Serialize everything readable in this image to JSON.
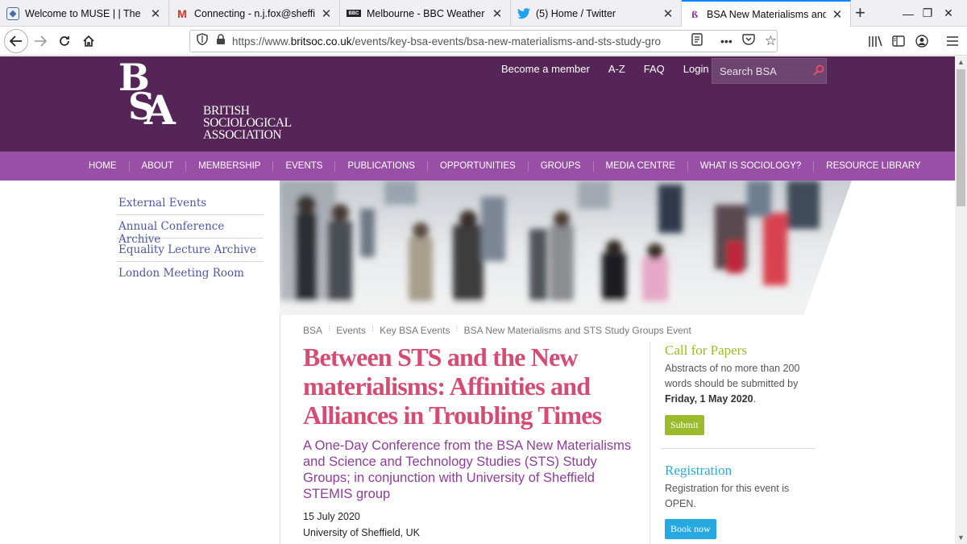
{
  "browser": {
    "tabs": [
      {
        "title": "Welcome to MUSE | | The Univ",
        "favicon": "shield-icon",
        "active": false
      },
      {
        "title": "Connecting - n.j.fox@sheffield.",
        "favicon": "gmail-icon",
        "active": false
      },
      {
        "title": "Melbourne - BBC Weather",
        "favicon": "bbc-icon",
        "active": false
      },
      {
        "title": "(5) Home / Twitter",
        "favicon": "twitter-icon",
        "active": false
      },
      {
        "title": "BSA New Materialisms and STS",
        "favicon": "bsa-icon",
        "active": true
      }
    ],
    "url_prefix": "https://www.",
    "url_domain": "britsoc.co.uk",
    "url_path": "/events/key-bsa-events/bsa-new-materialisms-and-sts-study-grou",
    "dots": "•••"
  },
  "site": {
    "logo_letters": "BSA",
    "logo_text_1": "BRITISH",
    "logo_text_2": "SOCIOLOGICAL",
    "logo_text_3": "ASSOCIATION",
    "top_links": [
      "Become a member",
      "A-Z",
      "FAQ",
      "Login"
    ],
    "search_placeholder": "Search BSA",
    "nav": [
      "Home",
      "About",
      "Membership",
      "Events",
      "Publications",
      "Opportunities",
      "Groups",
      "Media Centre",
      "What is Sociology?",
      "Resource Library"
    ],
    "sidebar": [
      "External Events",
      "Annual Conference Archive",
      "Equality Lecture Archive",
      "London Meeting Room"
    ],
    "breadcrumb": [
      "BSA",
      "Events",
      "Key BSA Events",
      "BSA New Materialisms and STS Study Groups Event"
    ],
    "title": "Between STS and the New materialisms: Affinities and Alliances in Troubling Times",
    "subtitle": "A One-Day Conference from the BSA New Materialisms and Science and Technology Studies (STS) Study Groups; in conjunction with University of Sheffield STEMIS group",
    "date": "15 July 2020",
    "venue": "University of Sheffield, UK",
    "call": {
      "heading": "Call for Papers",
      "text": "Abstracts of no more than 200 words should be submitted by",
      "deadline": "Friday, 1 May 2020",
      "deadline_suffix": ".",
      "button": "Submit"
    },
    "registration": {
      "heading": "Registration",
      "text": "Registration for this event is OPEN.",
      "button": "Book now"
    }
  },
  "colors": {
    "header_purple": "#552557",
    "nav_purple": "#9a4fa6",
    "title_pink": "#d64b72",
    "subtitle_purple": "#8d3e99",
    "call_green": "#9bbb2c",
    "registration_blue": "#26a9e0"
  }
}
